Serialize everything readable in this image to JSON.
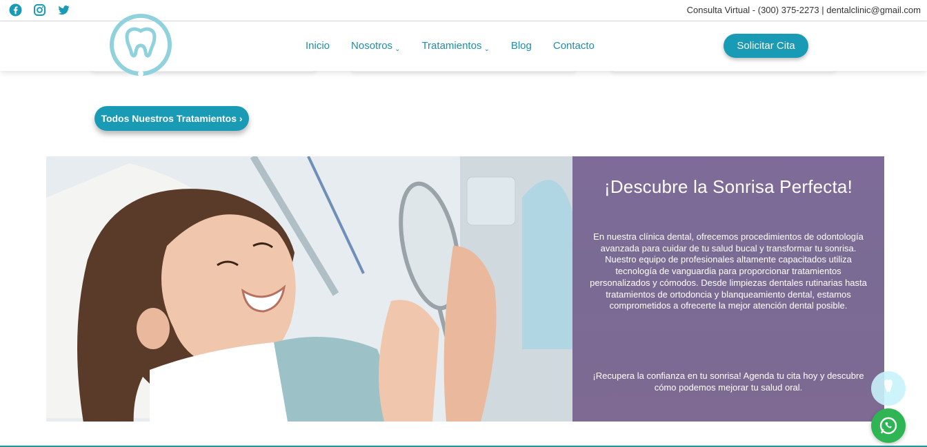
{
  "topbar": {
    "social": [
      "facebook-icon",
      "instagram-icon",
      "twitter-icon"
    ],
    "contact_text": "Consulta Virtual - (300) 375-2273 | dentalclinic@gmail.com"
  },
  "header": {
    "nav": [
      {
        "label": "Inicio",
        "has_dropdown": false
      },
      {
        "label": "Nosotros",
        "has_dropdown": true
      },
      {
        "label": "Tratamientos",
        "has_dropdown": true
      },
      {
        "label": "Blog",
        "has_dropdown": false
      },
      {
        "label": "Contacto",
        "has_dropdown": false
      }
    ],
    "cta_label": "Solicitar Cita"
  },
  "treatments_button_label": "Todos Nuestros Tratamientos ›",
  "hero": {
    "title": "¡Descubre la Sonrisa Perfecta!",
    "body": "En nuestra clínica dental, ofrecemos procedimientos de odontología avanzada para cuidar de tu salud bucal y transformar tu sonrisa. Nuestro equipo de profesionales altamente capacitados utiliza tecnología de vanguardia para proporcionar tratamientos personalizados y cómodos. Desde limpiezas dentales rutinarias hasta tratamientos de ortodoncia y blanqueamiento dental, estamos comprometidos a ofrecerte la mejor atención dental posible.",
    "footer": "¡Recupera la confianza en tu sonrisa! Agenda tu cita hoy y descubre cómo podemos mejorar tu salud oral."
  },
  "colors": {
    "brand": "#1a9bb5",
    "panel": "#7b6b95",
    "whatsapp": "#2fb554"
  }
}
